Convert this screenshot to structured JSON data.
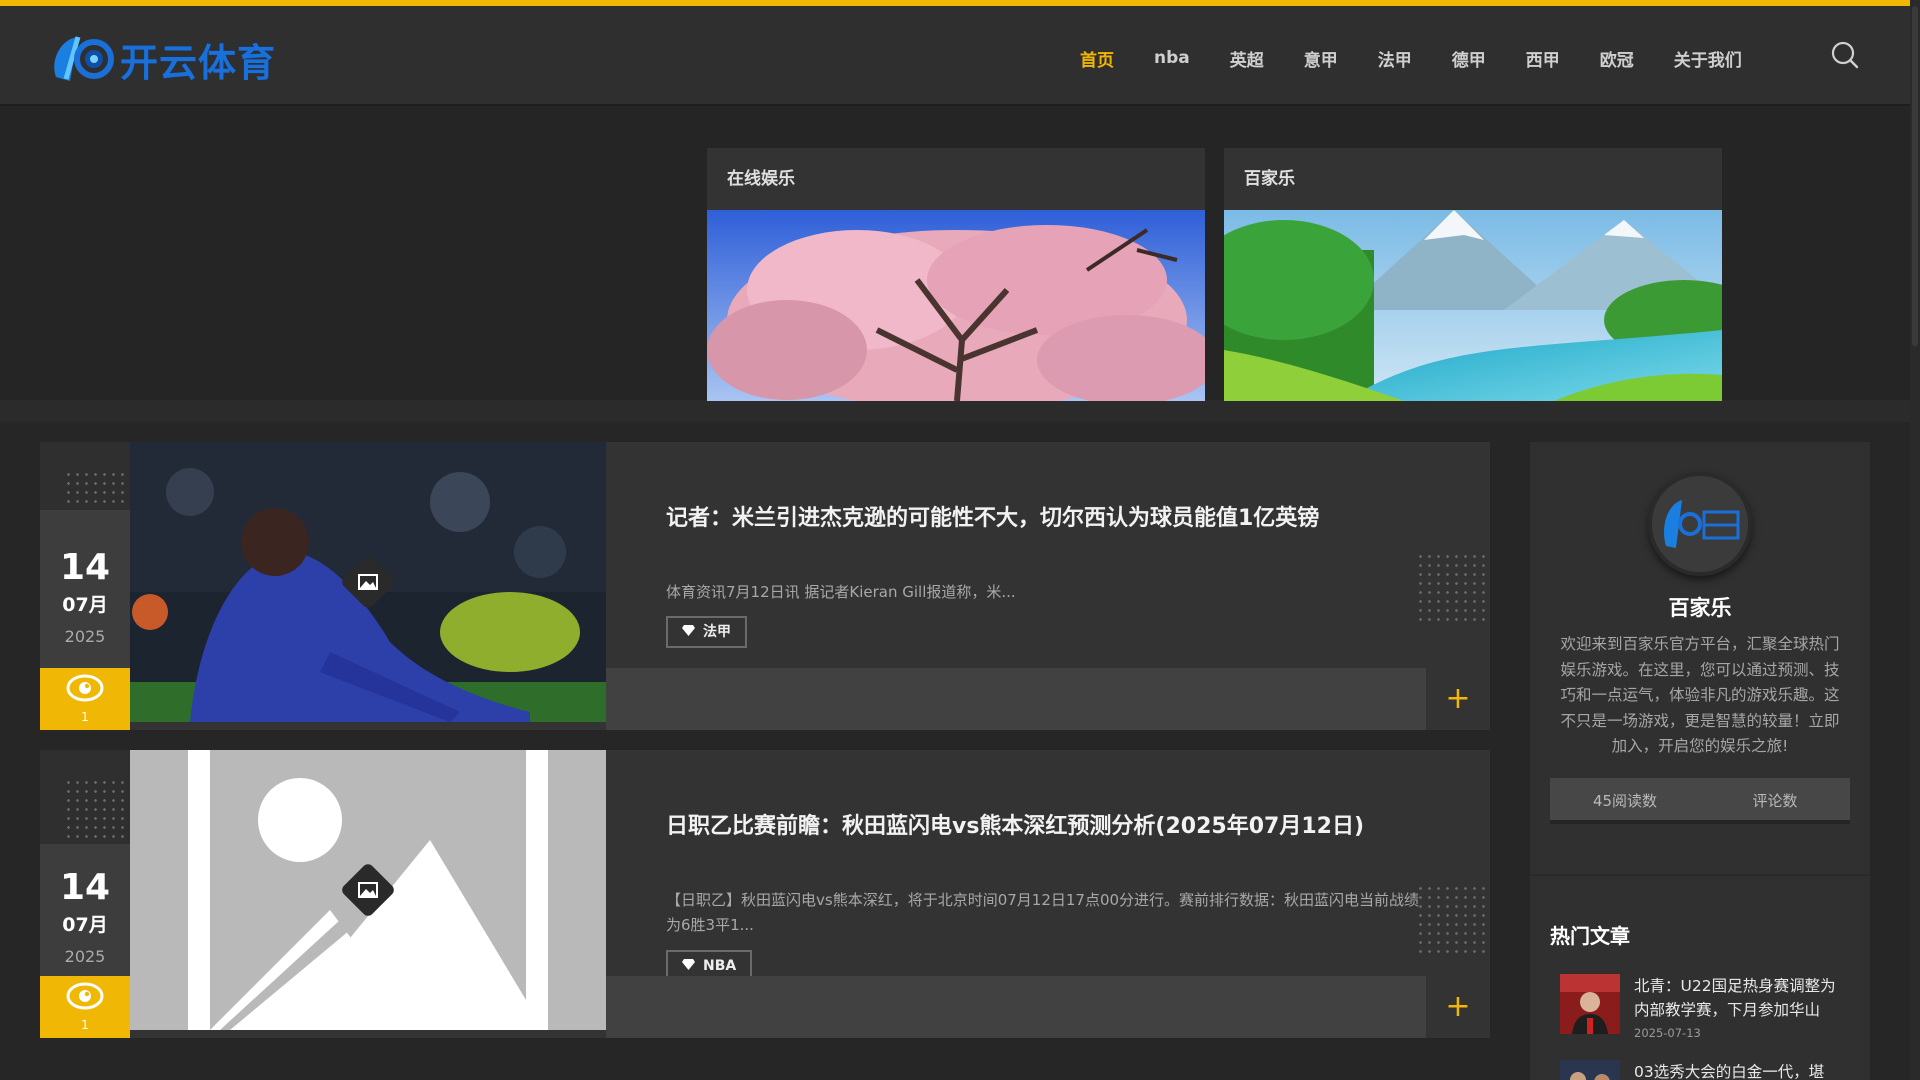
{
  "brand": {
    "logo_text": "开云体育",
    "accent": "#f1b705"
  },
  "nav": {
    "items": [
      "首页",
      "nba",
      "英超",
      "意甲",
      "法甲",
      "德甲",
      "西甲",
      "欧冠",
      "关于我们"
    ],
    "active_index": 0
  },
  "banners": [
    {
      "label": "在线娱乐"
    },
    {
      "label": "百家乐"
    }
  ],
  "posts": [
    {
      "day": "14",
      "month": "07月",
      "year": "2025",
      "views": "1",
      "title": "记者：米兰引进杰克逊的可能性不大，切尔西认为球员能值1亿英镑",
      "excerpt": "体育资讯7月12日讯 据记者Kieran Gill报道称，米...",
      "tag": "法甲"
    },
    {
      "day": "14",
      "month": "07月",
      "year": "2025",
      "views": "1",
      "title": "日职乙比赛前瞻：秋田蓝闪电vs熊本深红预测分析(2025年07月12日)",
      "excerpt": "【日职乙】秋田蓝闪电vs熊本深红，将于北京时间07月12日17点00分进行。赛前排行数据：秋田蓝闪电当前战绩为6胜3平1...",
      "tag": "NBA"
    }
  ],
  "sidebar": {
    "name": "百家乐",
    "description": "欢迎来到百家乐官方平台，汇聚全球热门娱乐游戏。在这里，您可以通过预测、技巧和一点运气，体验非凡的游戏乐趣。这不只是一场游戏，更是智慧的较量！立即加入，开启您的娱乐之旅!",
    "stats": {
      "reads": "45阅读数",
      "comments": "评论数"
    },
    "hot_title": "热门文章",
    "hot_articles": [
      {
        "title": "北青：U22国足热身赛调整为内部教学赛，下月参加华山",
        "date": "2025-07-13"
      },
      {
        "title": "03选秀大会的白金一代，堪",
        "date": ""
      }
    ]
  }
}
